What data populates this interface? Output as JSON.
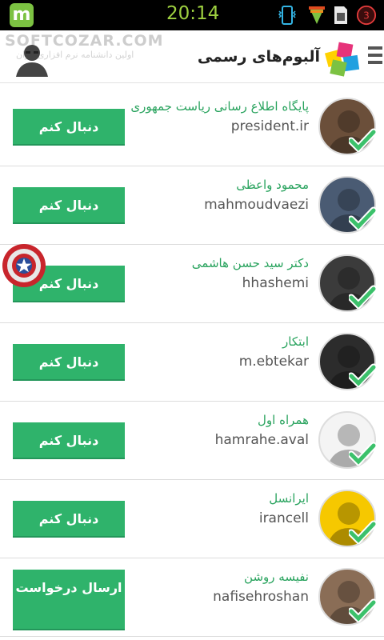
{
  "statusbar": {
    "app_icon_letter": "m",
    "time": "20:14",
    "battery_level": "3",
    "icons": [
      "vibrate-icon",
      "signal-icon",
      "sim-icon",
      "battery-icon"
    ]
  },
  "header": {
    "watermark": "SOFTCOZAR.COM",
    "watermark_sub": "اولین دانشنامه نرم افزاری ایران",
    "title": "آلبوم‌های رسمی",
    "logo_icon": "photo-albums-logo",
    "menu_icon": "menu-icon",
    "avatar_icon": "user-avatar-icon"
  },
  "accounts": [
    {
      "name": "پایگاه اطلاع رسانی ریاست جمهوری",
      "username": "president.ir",
      "button": "دنبال کنم",
      "avatar_color": "#6b4f3a"
    },
    {
      "name": "محمود واعظی",
      "username": "mahmoudvaezi",
      "button": "دنبال کنم",
      "avatar_color": "#4a5b73"
    },
    {
      "name": "دکتر سید حسن هاشمی",
      "username": "hhashemi",
      "button": "دنبال کنم",
      "avatar_color": "#3b3b3b"
    },
    {
      "name": "ابتکار",
      "username": "m.ebtekar",
      "button": "دنبال کنم",
      "avatar_color": "#2c2c2c"
    },
    {
      "name": "همراه اول",
      "username": "hamrahe.aval",
      "button": "دنبال کنم",
      "avatar_color": "#f4f4f4"
    },
    {
      "name": "ایرانسل",
      "username": "irancell",
      "button": "دنبال کنم",
      "avatar_color": "#f6c800"
    },
    {
      "name": "نفیسه روشن",
      "username": "nafisehroshan",
      "button": "ارسال درخواست",
      "avatar_color": "#8a6d56"
    }
  ],
  "floater_icon": "captain-america-shield-icon",
  "colors": {
    "accent": "#2fb36b",
    "name_text": "#29a35e",
    "check": "#3cc16b"
  }
}
